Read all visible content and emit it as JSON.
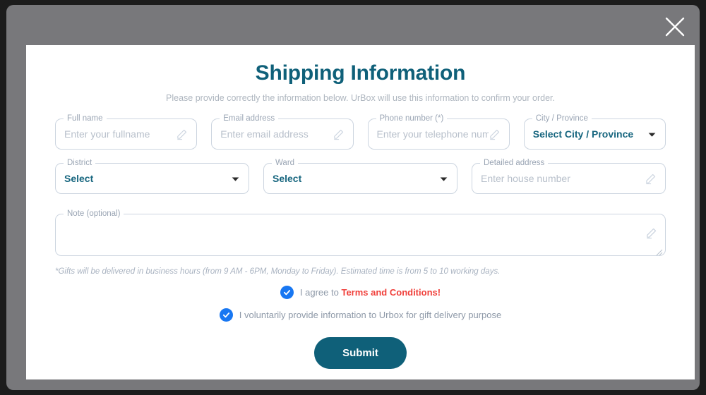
{
  "colors": {
    "brand_teal": "#0f6079",
    "overlay_gray": "#78787b",
    "bezel": "#1c1c1c",
    "border": "#ccd5e0",
    "placeholder": "#b8c0cb",
    "legend": "#9aa5b4",
    "checkbox_blue": "#1877f2",
    "terms_red": "#f0413c"
  },
  "modal": {
    "close_icon": "close-icon",
    "title": "Shipping Information",
    "subtitle": "Please provide correctly the information below. UrBox will use this information to confirm your order."
  },
  "form": {
    "row1": [
      {
        "legend": "Full name",
        "placeholder": "Enter your fullname",
        "type": "text",
        "icon": "pencil-icon"
      },
      {
        "legend": "Email address",
        "placeholder": "Enter email address",
        "type": "text",
        "icon": "pencil-icon"
      },
      {
        "legend": "Phone number (*)",
        "placeholder": "Enter your telephone number",
        "type": "text",
        "icon": "pencil-icon"
      },
      {
        "legend": "City / Province",
        "value": "Select City / Province",
        "type": "select",
        "icon": "chevron-down-icon"
      }
    ],
    "row2": [
      {
        "legend": "District",
        "value": "Select",
        "type": "select",
        "icon": "chevron-down-icon"
      },
      {
        "legend": "Ward",
        "value": "Select",
        "type": "select",
        "icon": "chevron-down-icon"
      },
      {
        "legend": "Detailed address",
        "placeholder": "Enter house number",
        "type": "text",
        "icon": "pencil-icon"
      }
    ],
    "note": {
      "legend": "Note (optional)",
      "placeholder": "",
      "icon": "pencil-icon",
      "resize_handle": "resize-grip-icon"
    },
    "disclaimer": "*Gifts will be delivered in business hours (from 9 AM - 6PM, Monday to Friday). Estimated time is from 5 to 10 working days.",
    "agreements": [
      {
        "checked": true,
        "text_before": "I agree to ",
        "link_text": "Terms and Conditions!",
        "text_after": ""
      },
      {
        "checked": true,
        "text_before": "I voluntarily provide information to Urbox for gift delivery purpose",
        "link_text": "",
        "text_after": ""
      }
    ],
    "submit_label": "Submit"
  }
}
